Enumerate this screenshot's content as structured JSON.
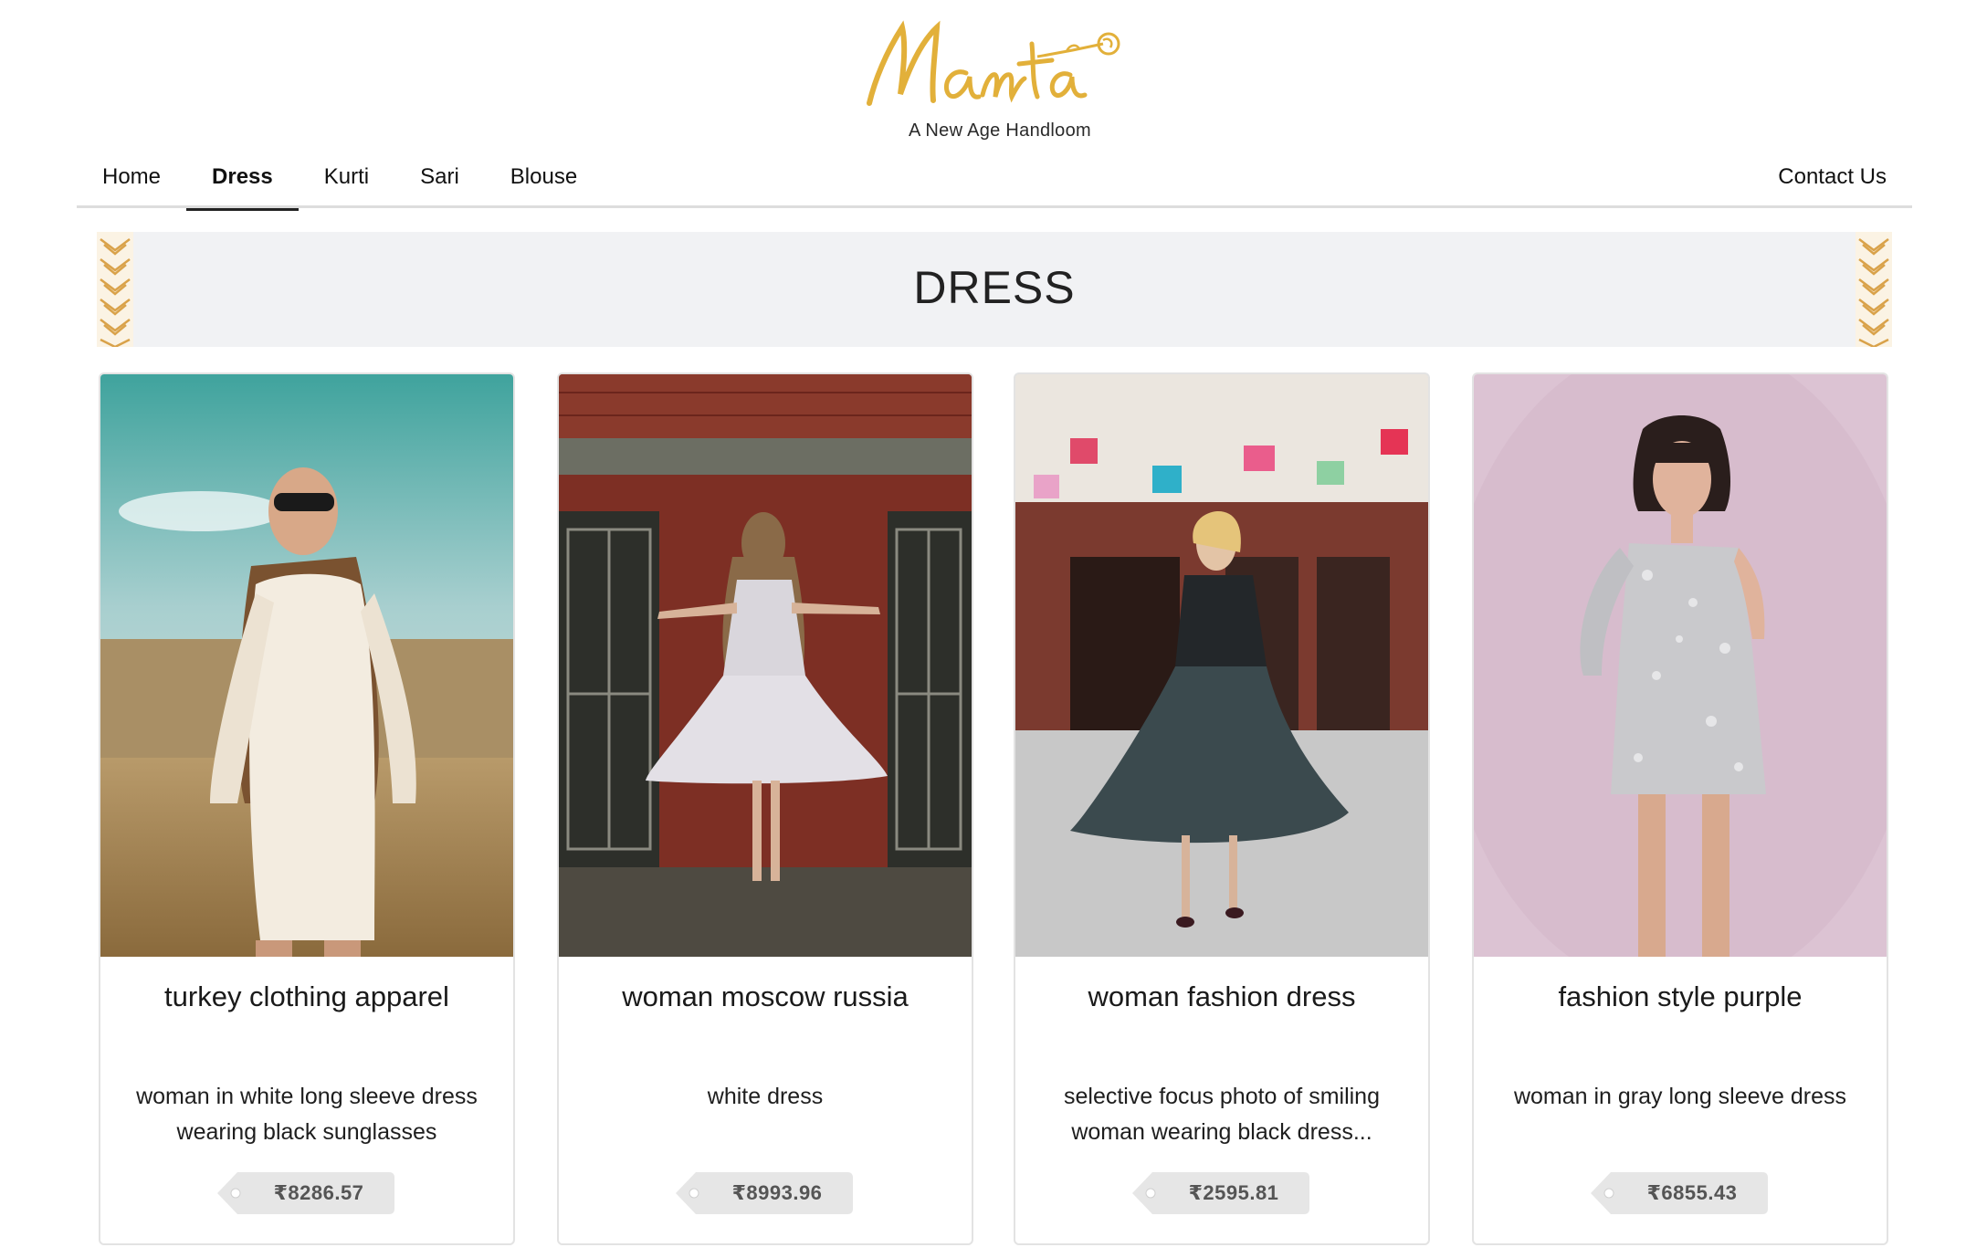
{
  "brand": {
    "name": "Mamta",
    "tagline": "A New Age Handloom",
    "color": "#e2b03a"
  },
  "nav": {
    "items": [
      {
        "label": "Home",
        "active": false
      },
      {
        "label": "Dress",
        "active": true
      },
      {
        "label": "Kurti",
        "active": false
      },
      {
        "label": "Sari",
        "active": false
      },
      {
        "label": "Blouse",
        "active": false
      }
    ],
    "contact": "Contact Us"
  },
  "banner": {
    "title": "DRESS"
  },
  "products": [
    {
      "title": "turkey clothing apparel",
      "description": "woman in white long sleeve dress wearing black sunglasses",
      "price": "₹8286.57",
      "image": "woman-white-shirt-dress-sunglasses"
    },
    {
      "title": "woman moscow russia",
      "description": "white dress",
      "price": "₹8993.96",
      "image": "woman-white-dress-brick-wall"
    },
    {
      "title": "woman fashion dress",
      "description": "selective focus photo of smiling woman wearing black dress...",
      "price": "₹2595.81",
      "image": "woman-black-pleated-dress-street"
    },
    {
      "title": "fashion style purple",
      "description": "woman in gray long sleeve dress",
      "price": "₹6855.43",
      "image": "woman-silver-sequin-dress-pink"
    }
  ]
}
